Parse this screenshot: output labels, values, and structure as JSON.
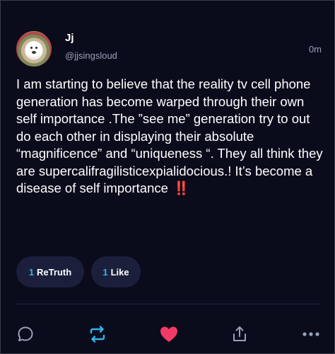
{
  "post": {
    "author": {
      "display_name": "Jj",
      "handle": "@jjsingsloud"
    },
    "timestamp": "0m",
    "body_text": "I am starting to believe that the reality tv cell phone generation has become warped through their own self importance .The ”see me” generation try to out do each other in displaying their absolute “magnificence” and “uniqueness “. They all think they are supercalifragilisticexpialidocious.! It’s become a disease of self importance",
    "emoji": "‼️"
  },
  "stats": {
    "retruth_count": "1",
    "retruth_label": "ReTruth",
    "like_count": "1",
    "like_label": "Like"
  },
  "actions": [
    {
      "icon": "reply-icon"
    },
    {
      "icon": "retruth-icon"
    },
    {
      "icon": "heart-icon"
    },
    {
      "icon": "share-icon"
    },
    {
      "icon": "more-icon"
    }
  ],
  "colors": {
    "background": "#0a0c1c",
    "accent_blue": "#34b3ea",
    "like_pink": "#f23a66",
    "pill_bg": "#1c1f3c",
    "muted_text": "#9aa0b4"
  }
}
